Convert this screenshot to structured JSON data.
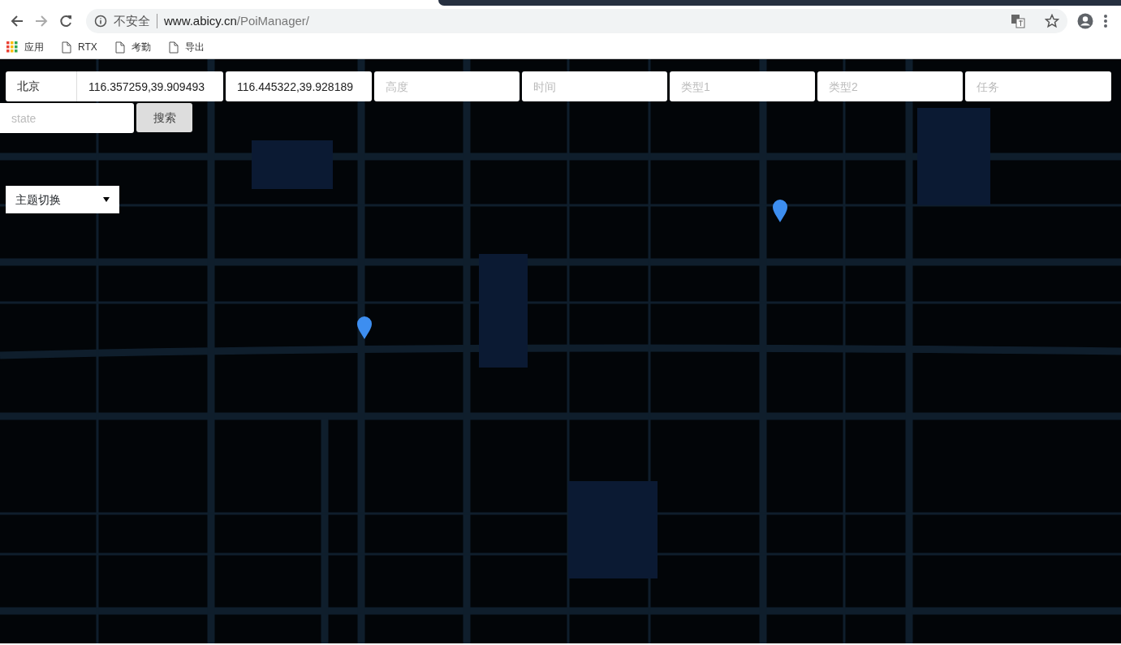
{
  "browser": {
    "security_label": "不安全",
    "url_host": "www.abicy.cn",
    "url_path": "/PoiManager/",
    "bookmarks": [
      {
        "label": "应用",
        "kind": "apps"
      },
      {
        "label": "RTX",
        "kind": "page"
      },
      {
        "label": "考勤",
        "kind": "page"
      },
      {
        "label": "导出",
        "kind": "page"
      }
    ]
  },
  "search_form": {
    "fields": [
      {
        "value": "北京"
      },
      {
        "value": "116.357259,39.909493"
      },
      {
        "value": "116.445322,39.928189"
      },
      {
        "placeholder": "高度"
      },
      {
        "placeholder": "时间"
      },
      {
        "placeholder": "类型1"
      },
      {
        "placeholder": "类型2"
      },
      {
        "placeholder": "任务"
      },
      {
        "placeholder": "state"
      }
    ],
    "search_button": "搜索",
    "theme_select": "主题切换"
  }
}
